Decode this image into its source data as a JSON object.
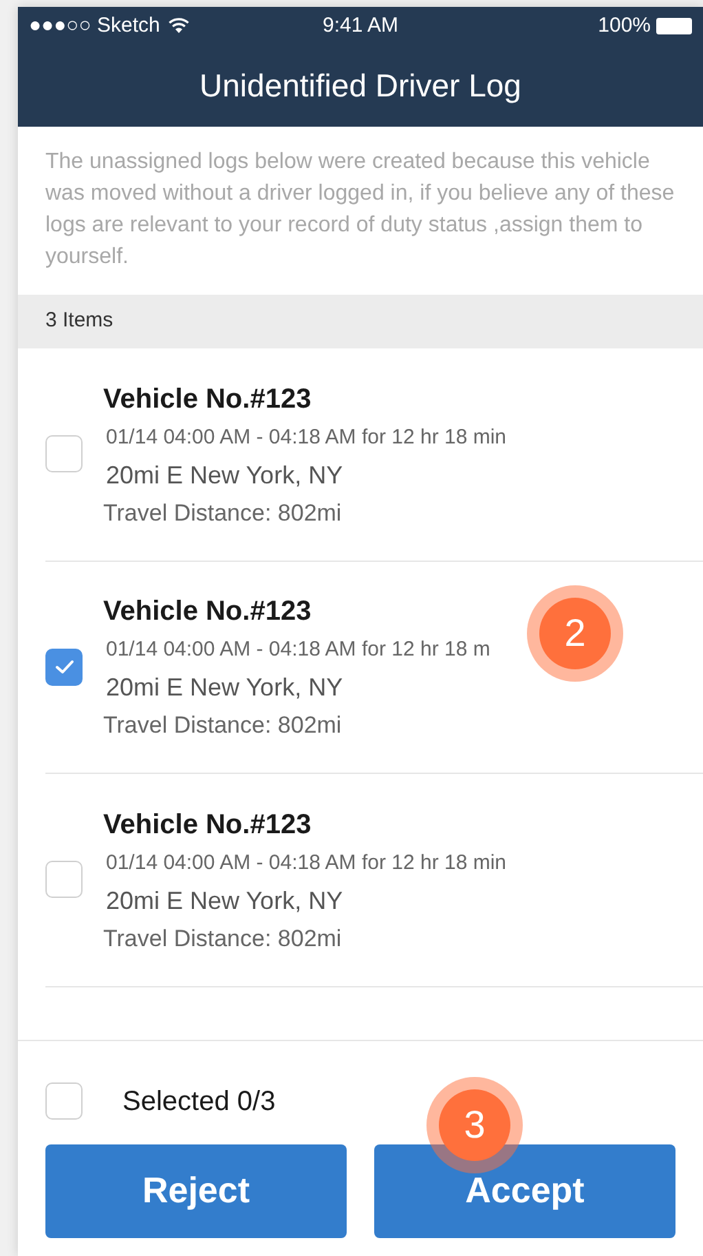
{
  "status_bar": {
    "carrier": "●●●○○ Sketch",
    "time": "9:41 AM",
    "battery": "100%"
  },
  "header": {
    "title": "Unidentified Driver Log"
  },
  "notice": "The unassigned logs below were created because this vehicle was moved without a driver logged in, if you believe any of these logs are relevant to your record of duty status ,assign them to yourself.",
  "section": {
    "label": "3 Items"
  },
  "logs": [
    {
      "vehicle": "Vehicle No.#123",
      "time": "01/14 04:00 AM - 04:18 AM for 12 hr 18 min",
      "location": "20mi E New York, NY",
      "distance": "Travel Distance: 802mi",
      "checked": false
    },
    {
      "vehicle": "Vehicle No.#123",
      "time": "01/14 04:00 AM - 04:18 AM for 12 hr 18 m",
      "location": "20mi E New York, NY",
      "distance": "Travel Distance: 802mi",
      "checked": true
    },
    {
      "vehicle": "Vehicle No.#123",
      "time": "01/14 04:00 AM - 04:18 AM for 12 hr 18 min",
      "location": "20mi E New York, NY",
      "distance": "Travel Distance: 802mi",
      "checked": false
    }
  ],
  "footer": {
    "select_all": {
      "label": "Selected 0/3",
      "checked": false
    },
    "buttons": [
      "Reject",
      "Accept"
    ]
  },
  "annotations": [
    "2",
    "3"
  ]
}
